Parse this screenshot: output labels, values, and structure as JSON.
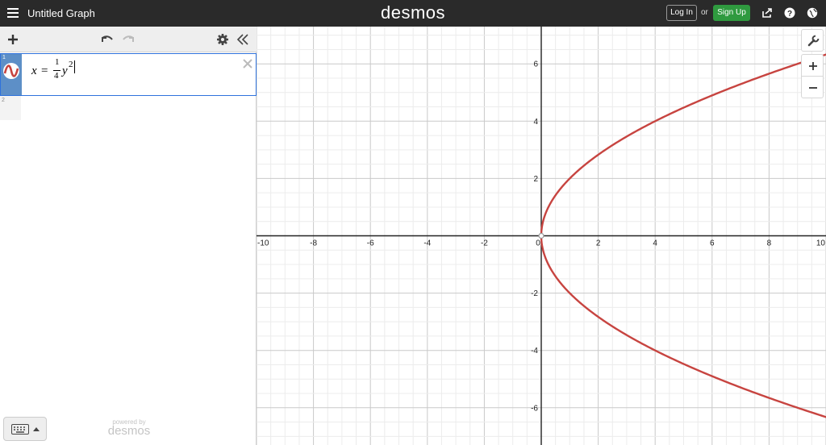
{
  "header": {
    "title": "Untitled Graph",
    "logo": "desmos",
    "login_label": "Log In",
    "or_label": "or",
    "signup_label": "Sign Up",
    "icons": [
      "menu-icon",
      "share-icon",
      "help-icon",
      "language-globe-icon"
    ]
  },
  "sidebar": {
    "toolbar_icons": [
      "add-icon",
      "undo-icon",
      "redo-icon",
      "settings-gear-icon",
      "collapse-chevrons-icon"
    ],
    "expressions": [
      {
        "index": "1",
        "lhs": "x",
        "equals": "=",
        "frac_num": "1",
        "frac_den": "4",
        "var": "y",
        "exp": "2",
        "color": "#c74440"
      },
      {
        "index": "2"
      }
    ],
    "keyboard_icon": "keyboard-icon",
    "powered_by": "powered by",
    "powered_logo": "desmos"
  },
  "graph": {
    "x_range": [
      -10,
      10
    ],
    "y_range": [
      -7.3,
      7.3
    ],
    "x_ticks": [
      "-10",
      "-8",
      "-6",
      "-4",
      "-2",
      "0",
      "2",
      "4",
      "6",
      "8",
      "10"
    ],
    "y_ticks": [
      "6",
      "4",
      "2",
      "-2",
      "-4",
      "-6"
    ],
    "grid": true,
    "curve_equation": "x = (1/4) y^2",
    "curve_color": "#c74440",
    "tools": [
      "wrench-icon",
      "zoom-in-icon",
      "zoom-out-icon"
    ]
  }
}
